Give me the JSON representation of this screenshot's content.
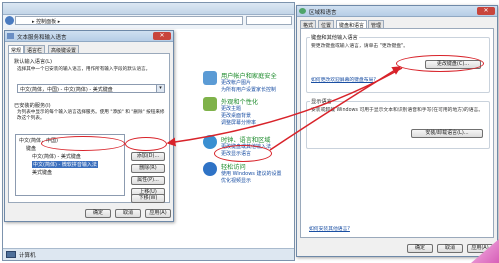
{
  "control_panel": {
    "address_text": "▸ 控制面板 ▸",
    "status_text": "计算机",
    "categories": [
      {
        "title": "用户帐户和家庭安全",
        "subs": [
          "更改帐户图片",
          "为所有用户设置家长控制"
        ],
        "color": "#5b9bd5"
      },
      {
        "title": "外观和个性化",
        "subs": [
          "更改主题",
          "更改桌面背景",
          "调整屏幕分辨率"
        ],
        "color": "#7fb24a"
      },
      {
        "title": "时钟、语言和区域",
        "subs": [
          "更改键盘或其他输入法",
          "更改显示语言"
        ],
        "color": "#3a8fd1"
      },
      {
        "title": "轻松访问",
        "subs": [
          "使用 Windows 建议的设置",
          "优化视频显示"
        ],
        "color": "#2f73c6"
      }
    ]
  },
  "text_services": {
    "title": "文本服务和输入语言",
    "close": "✕",
    "tabs": [
      "常规",
      "语言栏",
      "高级键设置"
    ],
    "default_lang_label": "默认输入语言(L)",
    "default_lang_desc": "选择其中一个已安装的输入语言，用作所有输入字段的默认语言。",
    "default_lang_value": "中文(简体，中国) - 中文(简体) - 美式键盘",
    "installed_label": "已安装的服务(I)",
    "installed_desc": "为列表中显示的每个输入语言选择服务。使用 \"添加\" 和 \"删除\" 按钮来修改这个列表。",
    "tree": [
      "中文(简体，中国)",
      "键盘",
      "中文(简体) - 美式键盘",
      "中文(简体) - 微软拼音输入法",
      "美式键盘"
    ],
    "side_buttons": [
      "添加(D)...",
      "删除(R)",
      "属性(P)...",
      "上移(U)",
      "下移(W)"
    ],
    "footer_buttons": [
      "确定",
      "取消",
      "应用(A)"
    ]
  },
  "region_language": {
    "title": "区域和语言",
    "tabs": [
      "格式",
      "位置",
      "键盘和语言",
      "管理"
    ],
    "keyboard_group": "键盘和其他输入语言",
    "keyboard_desc": "要更改键盘或输入语言，请单击 \"更改键盘\"。",
    "keyboard_button": "更改键盘(C)...",
    "keyboard_link": "如何更改欢迎屏幕的键盘布局?",
    "display_group": "显示语言",
    "display_desc": "安装或卸载 Windows 可用于显示文本和识别语音和手写(在可用的地方)的语言。",
    "display_button": "安装/卸载语言(L)...",
    "help_link": "如何安装其他语言?",
    "footer_buttons": [
      "确定",
      "取消",
      "应用(A)"
    ]
  },
  "annotation_color": "#d8232a"
}
